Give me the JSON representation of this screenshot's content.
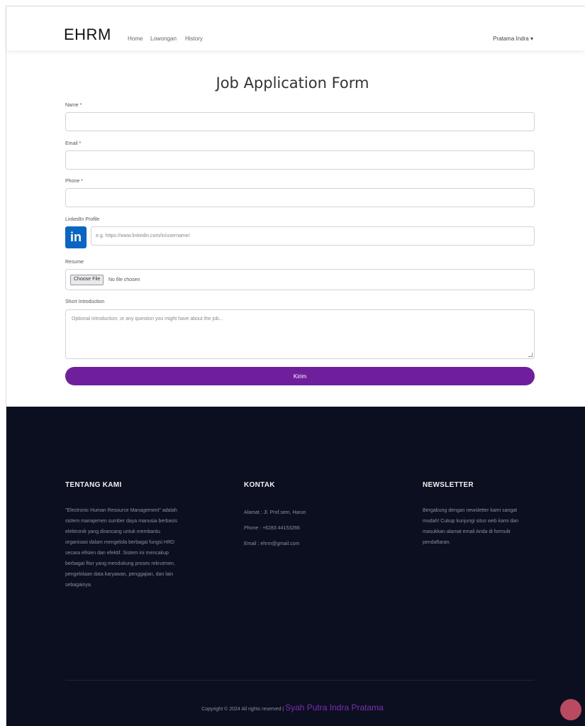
{
  "nav": {
    "brand": "EHRM",
    "links": [
      "Home",
      "Lowongan",
      "History"
    ],
    "user": "Pratama Indra ▾"
  },
  "form": {
    "title": "Job Application Form",
    "name_label": "Name *",
    "email_label": "Email *",
    "phone_label": "Phone *",
    "linkedin_label": "LinkedIn Profile",
    "linkedin_placeholder": "e.g. https://www.linkedin.com/in/username/",
    "resume_label": "Resume",
    "file_button": "Choose File",
    "file_status": "No file chosen",
    "intro_label": "Short Introduction",
    "intro_placeholder": "Optional introduction, or any question you might have about the job...",
    "submit": "Kirim"
  },
  "footer": {
    "about_heading": "TENTANG KAMI",
    "about_text": "\"Electronic Human Resource Management\" adalah sistem manajemen sumber daya manusia berbasis elektronik yang dirancang untuk membantu organisasi dalam mengelola berbagai fungsi HRD secara efisien dan efektif. Sistem ini mencakup berbagai fitur yang mendukung proses rekrutmen, pengelolaan data karyawan, penggajian, dan lain sebagainya.",
    "contact_heading": "KONTAK",
    "contact_items": [
      "Alamat : Jl. Prof.sem, Harun",
      "Phone : +6283 44153266",
      "Email : ehrm@gmail.com"
    ],
    "newsletter_heading": "NEWSLETTER",
    "newsletter_text": "Bergabung dengan newsletter kami sangat mudah! Cukup kunjungi situs web kami dan masukkan alamat email Anda di formulir pendaftaran.",
    "copyright_prefix": "Copyright © 2024 All rights reserved | ",
    "copyright_author": "Syah Putra Indra Pratama"
  }
}
